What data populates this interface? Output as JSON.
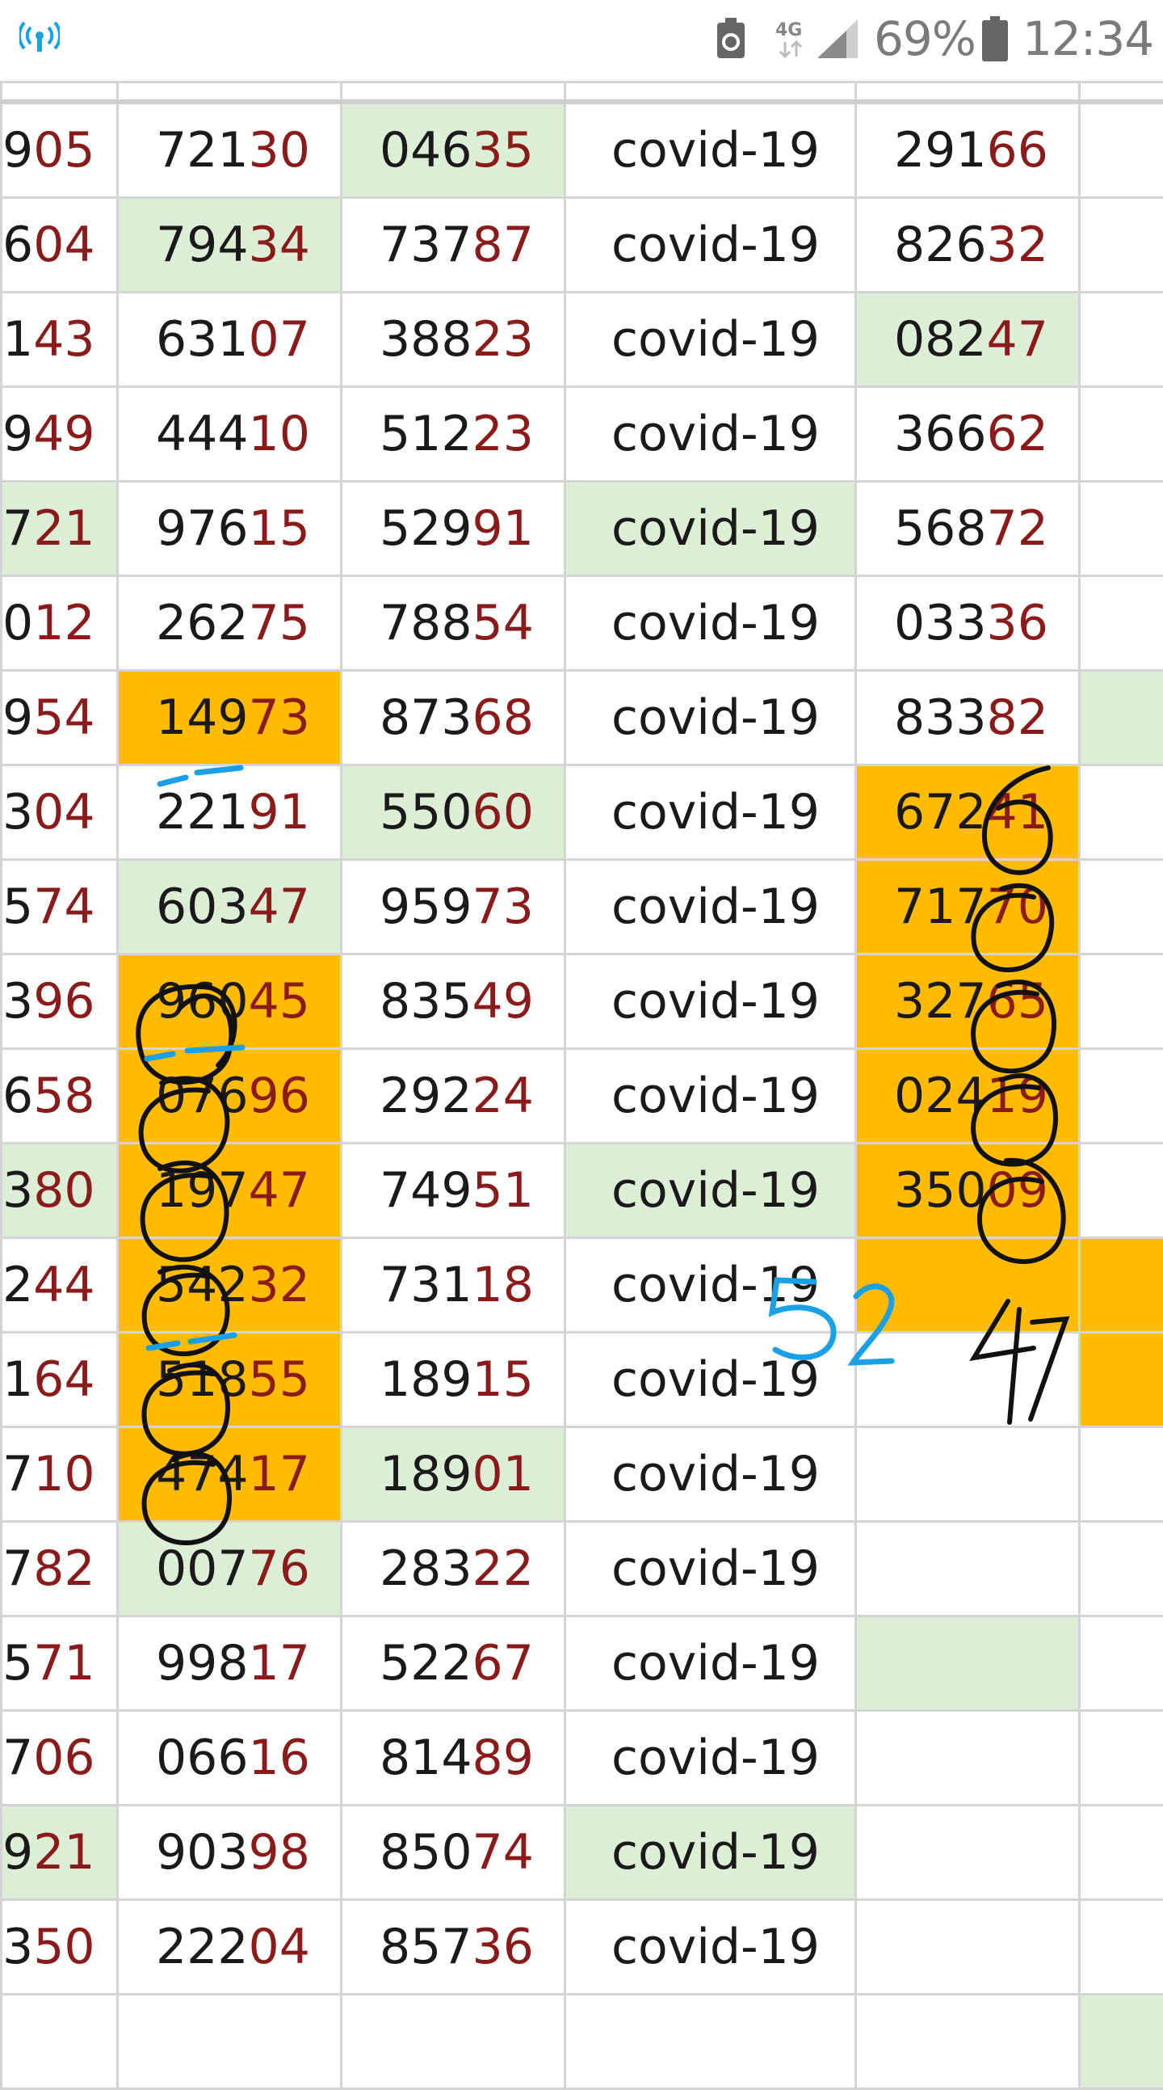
{
  "status_bar": {
    "battery": "69%",
    "time": "12:34",
    "network": "4G",
    "icons": [
      "wifi-hotspot-icon",
      "recycle-icon",
      "4g-icon",
      "signal-icon",
      "battery-icon"
    ]
  },
  "colors": {
    "highlight_green": "#ddeed6",
    "highlight_orange": "#ffbb00",
    "digit_red": "#8b1a1a",
    "pen_black": "#111111",
    "pen_blue": "#1aa0e6"
  },
  "rows": [
    [
      {
        "pre": "9",
        "hl": "05"
      },
      {
        "pre": "721",
        "hl": "30"
      },
      {
        "pre": "046",
        "hl": "35",
        "bg": "green"
      },
      {
        "pre": "covid-19"
      },
      {
        "pre": "291",
        "hl": "66"
      }
    ],
    [
      {
        "pre": "6",
        "hl": "04"
      },
      {
        "pre": "794",
        "hl": "34",
        "bg": "green"
      },
      {
        "pre": "737",
        "hl": "87"
      },
      {
        "pre": "covid-19"
      },
      {
        "pre": "826",
        "hl": "32"
      }
    ],
    [
      {
        "pre": "1",
        "hl": "43"
      },
      {
        "pre": "631",
        "hl": "07"
      },
      {
        "pre": "388",
        "hl": "23"
      },
      {
        "pre": "covid-19"
      },
      {
        "pre": "082",
        "hl": "47",
        "bg": "green"
      }
    ],
    [
      {
        "pre": "9",
        "hl": "49"
      },
      {
        "pre": "444",
        "hl": "10"
      },
      {
        "pre": "512",
        "hl": "23"
      },
      {
        "pre": "covid-19"
      },
      {
        "pre": "366",
        "hl": "62"
      }
    ],
    [
      {
        "pre": "7",
        "hl": "21",
        "bg": "green"
      },
      {
        "pre": "976",
        "hl": "15"
      },
      {
        "pre": "529",
        "hl": "91"
      },
      {
        "pre": "covid-19",
        "bg": "green"
      },
      {
        "pre": "568",
        "hl": "72"
      }
    ],
    [
      {
        "pre": "0",
        "hl": "12"
      },
      {
        "pre": "262",
        "hl": "75"
      },
      {
        "pre": "788",
        "hl": "54"
      },
      {
        "pre": "covid-19"
      },
      {
        "pre": "033",
        "hl": "36"
      }
    ],
    [
      {
        "pre": "9",
        "hl": "54"
      },
      {
        "pre": "149",
        "hl": "73",
        "bg": "orange"
      },
      {
        "pre": "873",
        "hl": "68"
      },
      {
        "pre": "covid-19"
      },
      {
        "pre": "833",
        "hl": "82"
      },
      {
        "pre": "",
        "bg": "green"
      }
    ],
    [
      {
        "pre": "3",
        "hl": "04"
      },
      {
        "pre": "221",
        "hl": "91"
      },
      {
        "pre": "550",
        "hl": "60",
        "bg": "green"
      },
      {
        "pre": "covid-19"
      },
      {
        "pre": "672",
        "hl": "41",
        "bg": "orange"
      }
    ],
    [
      {
        "pre": "5",
        "hl": "74"
      },
      {
        "pre": "603",
        "hl": "47",
        "bg": "green"
      },
      {
        "pre": "959",
        "hl": "73"
      },
      {
        "pre": "covid-19"
      },
      {
        "pre": "717",
        "hl": "70",
        "bg": "orange"
      }
    ],
    [
      {
        "pre": "3",
        "hl": "96"
      },
      {
        "pre": "960",
        "hl": "45",
        "bg": "orange"
      },
      {
        "pre": "835",
        "hl": "49"
      },
      {
        "pre": "covid-19"
      },
      {
        "pre": "327",
        "hl": "65",
        "bg": "orange"
      }
    ],
    [
      {
        "pre": "6",
        "hl": "58"
      },
      {
        "pre": "076",
        "hl": "96",
        "bg": "orange"
      },
      {
        "pre": "292",
        "hl": "24"
      },
      {
        "pre": "covid-19"
      },
      {
        "pre": "024",
        "hl": "19",
        "bg": "orange"
      }
    ],
    [
      {
        "pre": "3",
        "hl": "80",
        "bg": "green"
      },
      {
        "pre": "197",
        "hl": "47",
        "bg": "orange"
      },
      {
        "pre": "749",
        "hl": "51"
      },
      {
        "pre": "covid-19",
        "bg": "green"
      },
      {
        "pre": "350",
        "hl": "09",
        "bg": "orange"
      }
    ],
    [
      {
        "pre": "2",
        "hl": "44"
      },
      {
        "pre": "542",
        "hl": "32",
        "bg": "orange"
      },
      {
        "pre": "731",
        "hl": "18"
      },
      {
        "pre": "covid-19"
      },
      {
        "pre": "",
        "bg": "orange"
      },
      {
        "pre": "",
        "bg": "orange"
      }
    ],
    [
      {
        "pre": "1",
        "hl": "64"
      },
      {
        "pre": "518",
        "hl": "55",
        "bg": "orange"
      },
      {
        "pre": "189",
        "hl": "15"
      },
      {
        "pre": "covid-19"
      },
      {
        "pre": ""
      },
      {
        "pre": "",
        "bg": "orange"
      }
    ],
    [
      {
        "pre": "7",
        "hl": "10"
      },
      {
        "pre": "474",
        "hl": "17",
        "bg": "orange"
      },
      {
        "pre": "189",
        "hl": "01",
        "bg": "green"
      },
      {
        "pre": "covid-19"
      },
      {
        "pre": ""
      }
    ],
    [
      {
        "pre": "7",
        "hl": "82"
      },
      {
        "pre": "007",
        "hl": "76",
        "bg": "green"
      },
      {
        "pre": "283",
        "hl": "22"
      },
      {
        "pre": "covid-19"
      },
      {
        "pre": ""
      }
    ],
    [
      {
        "pre": "5",
        "hl": "71"
      },
      {
        "pre": "998",
        "hl": "17"
      },
      {
        "pre": "522",
        "hl": "67"
      },
      {
        "pre": "covid-19"
      },
      {
        "pre": "",
        "bg": "green"
      }
    ],
    [
      {
        "pre": "7",
        "hl": "06"
      },
      {
        "pre": "066",
        "hl": "16"
      },
      {
        "pre": "814",
        "hl": "89"
      },
      {
        "pre": "covid-19"
      },
      {
        "pre": ""
      }
    ],
    [
      {
        "pre": "9",
        "hl": "21",
        "bg": "green"
      },
      {
        "pre": "903",
        "hl": "98"
      },
      {
        "pre": "850",
        "hl": "74"
      },
      {
        "pre": "covid-19",
        "bg": "green"
      },
      {
        "pre": ""
      }
    ],
    [
      {
        "pre": "3",
        "hl": "50"
      },
      {
        "pre": "222",
        "hl": "04"
      },
      {
        "pre": "857",
        "hl": "36"
      },
      {
        "pre": "covid-19"
      },
      {
        "pre": ""
      }
    ],
    [
      {
        "pre": ""
      },
      {
        "pre": ""
      },
      {
        "pre": ""
      },
      {
        "pre": ""
      },
      {
        "pre": ""
      },
      {
        "pre": "",
        "bg": "green"
      }
    ]
  ],
  "annotations": [
    {
      "text": "52",
      "color": "blue"
    },
    {
      "text": "47",
      "color": "black"
    }
  ]
}
